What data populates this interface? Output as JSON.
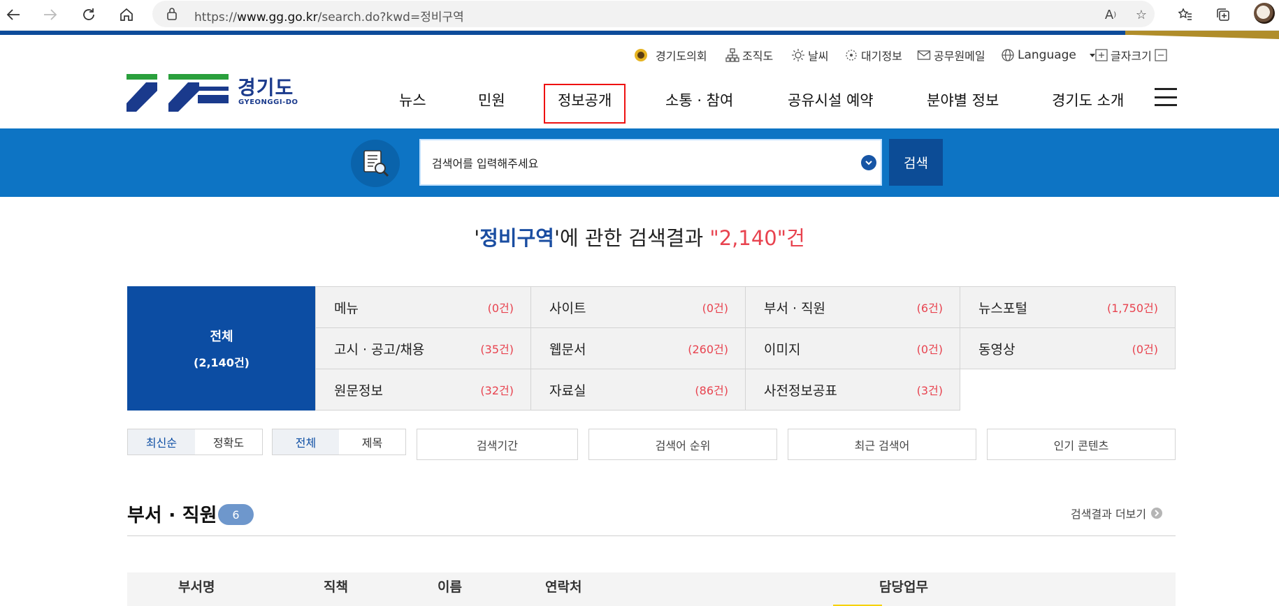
{
  "browser": {
    "url_prefix": "https://",
    "url_domain": "www.gg.go.kr",
    "url_path": "/search.do?kwd=정비구역"
  },
  "util_links": [
    "경기도의회",
    "조직도",
    "날씨",
    "대기정보",
    "공무원메일",
    "Language",
    "글자크기"
  ],
  "logo": {
    "name": "경기도",
    "sub": "GYEONGGI-DO"
  },
  "gnb": [
    "뉴스",
    "민원",
    "정보공개",
    "소통 · 참여",
    "공유시설 예약",
    "분야별 정보",
    "경기도 소개"
  ],
  "search": {
    "placeholder": "검색어를 입력해주세요",
    "button": "검색"
  },
  "headline": {
    "q_open": "'",
    "keyword": "정비구역",
    "q_close": "'",
    "middle": "에 관한 검색결과 ",
    "count": "\"2,140\"",
    "unit": "건"
  },
  "categories": {
    "all": {
      "label": "전체",
      "count": "(2,140건)"
    },
    "cells": [
      {
        "label": "메뉴",
        "count": "(0건)"
      },
      {
        "label": "사이트",
        "count": "(0건)"
      },
      {
        "label": "부서 · 직원",
        "count": "(6건)"
      },
      {
        "label": "뉴스포털",
        "count": "(1,750건)"
      },
      {
        "label": "고시 · 공고/채용",
        "count": "(35건)"
      },
      {
        "label": "웹문서",
        "count": "(260건)"
      },
      {
        "label": "이미지",
        "count": "(0건)"
      },
      {
        "label": "동영상",
        "count": "(0건)"
      },
      {
        "label": "원문정보",
        "count": "(32건)"
      },
      {
        "label": "자료실",
        "count": "(86건)"
      },
      {
        "label": "사전정보공표",
        "count": "(3건)"
      }
    ]
  },
  "sort": {
    "latest": "최신순",
    "accuracy": "정확도"
  },
  "scope": {
    "all": "전체",
    "title": "제목"
  },
  "filters": [
    "검색기간",
    "검색어 순위",
    "최근 검색어",
    "인기 콘텐츠"
  ],
  "section": {
    "title": "부서 · 직원",
    "badge": "6",
    "more": "검색결과 더보기",
    "columns": [
      "부서명",
      "직책",
      "이름",
      "연락처",
      "담당업무"
    ]
  }
}
